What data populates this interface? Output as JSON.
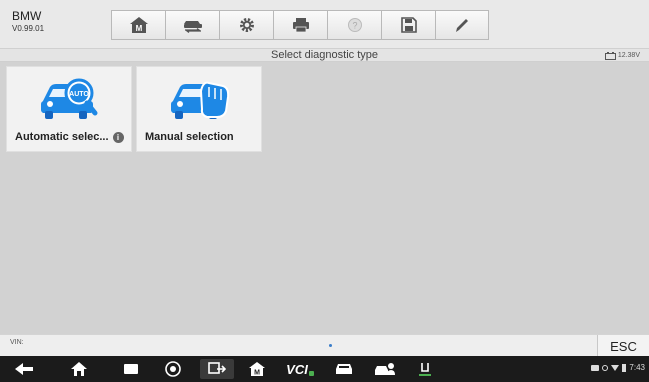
{
  "app": {
    "brand": "BMW",
    "version": "V0.99.01"
  },
  "toolbar": {
    "buttons": [
      {
        "icon": "home-m-icon"
      },
      {
        "icon": "vehicle-swap-icon"
      },
      {
        "icon": "gear-icon"
      },
      {
        "icon": "print-icon"
      },
      {
        "icon": "help-icon"
      },
      {
        "icon": "save-icon"
      },
      {
        "icon": "pen-icon"
      }
    ]
  },
  "status": {
    "title": "Select diagnostic type",
    "battery_voltage": "12.38V"
  },
  "tiles": [
    {
      "label": "Automatic selec...",
      "icon_text": "AUTO"
    },
    {
      "label": "Manual selection"
    }
  ],
  "footer": {
    "vin_label": "VIN:",
    "esc_label": "ESC"
  },
  "navbar": {
    "vcl_label": "VCI",
    "time": "7:43"
  },
  "colors": {
    "accent_blue": "#1e88e5",
    "content_bg": "#d2d2d2",
    "navbar_bg": "#1b1b1b"
  }
}
